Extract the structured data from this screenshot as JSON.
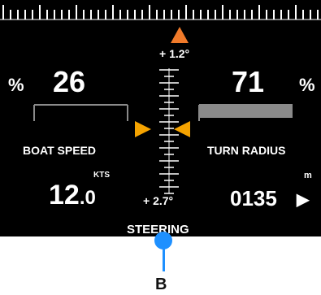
{
  "heading": {
    "top_offset": "+ 1.2°",
    "bottom_offset": "+ 2.7°",
    "pointer_color": "#f07a2a"
  },
  "boat_speed": {
    "percent": "26",
    "percent_symbol": "%",
    "label": "BOAT SPEED",
    "unit": "KTS",
    "value_main": "12",
    "value_decimal": ".0",
    "bar_level": 0.26
  },
  "turn_radius": {
    "percent": "71",
    "percent_symbol": "%",
    "label": "TURN RADIUS",
    "unit": "m",
    "value": "0135",
    "arrow": "▶",
    "bar_level": 0.71
  },
  "steering": {
    "label": "STEERING",
    "marker_color": "#f5a300"
  },
  "callout": {
    "label": "B",
    "color": "#1e90ff"
  }
}
